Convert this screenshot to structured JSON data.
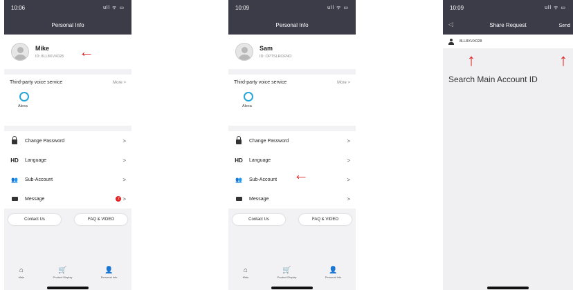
{
  "screens": [
    {
      "time": "10:06",
      "status_icons": "ull ᯤ ▭",
      "title": "Personal Info",
      "profile": {
        "name": "Mike",
        "id": "ID: 8LL8XVX028"
      },
      "voice": {
        "title": "Third-party voice service",
        "more": "More >",
        "alexa_label": "Alexa"
      },
      "menu": [
        {
          "icon": "lock-icon",
          "label": "Change Password",
          "chev": ">"
        },
        {
          "icon": "hd-icon",
          "icon_text": "HD",
          "label": "Language",
          "chev": ">"
        },
        {
          "icon": "sub-account-icon",
          "icon_text": "👥",
          "label": "Sub-Account",
          "chev": ">"
        },
        {
          "icon": "mail-icon",
          "label": "Message",
          "chev": ">",
          "badge": "2"
        }
      ],
      "buttons": {
        "contact": "Contact Us",
        "faq": "FAQ & VIDEO"
      },
      "tabs": [
        {
          "icon": "⌂",
          "label": "Main"
        },
        {
          "icon": "🛒",
          "label": "Product Display"
        },
        {
          "icon": "👤",
          "label": "Personal Info"
        }
      ]
    },
    {
      "time": "10:09",
      "status_icons": "ull ᯤ ▭",
      "title": "Personal Info",
      "profile": {
        "name": "Sam",
        "id": "ID: OPTSLROFNO"
      },
      "voice": {
        "title": "Third-party voice service",
        "more": "More >",
        "alexa_label": "Alexa"
      },
      "menu": [
        {
          "icon": "lock-icon",
          "label": "Change Password",
          "chev": ">"
        },
        {
          "icon": "hd-icon",
          "icon_text": "HD",
          "label": "Language",
          "chev": ">"
        },
        {
          "icon": "sub-account-icon",
          "icon_text": "👥",
          "label": "Sub-Account",
          "chev": ">"
        },
        {
          "icon": "mail-icon",
          "label": "Message",
          "chev": ">"
        }
      ],
      "buttons": {
        "contact": "Contact Us",
        "faq": "FAQ & VIDEO"
      },
      "tabs": [
        {
          "icon": "⌂",
          "label": "Main"
        },
        {
          "icon": "🛒",
          "label": "Product Display"
        },
        {
          "icon": "👤",
          "label": "Personal Info"
        }
      ]
    },
    {
      "time": "10:09",
      "status_icons": "ull ᯤ ▭",
      "title": "Share Request",
      "back": "◁",
      "send": "Send",
      "search_value": "8LL8XVX028"
    }
  ],
  "annotations": {
    "arrow_left": "←",
    "arrow_up": "↑",
    "search_caption": "Search Main Account ID"
  },
  "colors": {
    "header": "#3b3c48",
    "accent_red": "#e02020",
    "alexa": "#27a6d8"
  }
}
